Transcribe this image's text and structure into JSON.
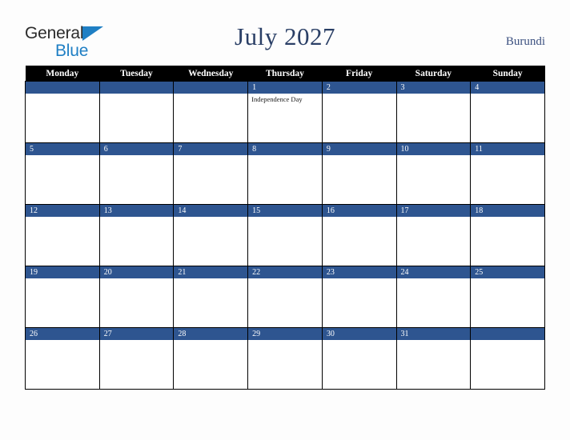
{
  "brand": {
    "name_part1": "General",
    "name_part2": "Blue",
    "triangle_color": "#1f7fc4",
    "text_color": "#2b2b2b"
  },
  "header": {
    "title": "July 2027",
    "country": "Burundi",
    "title_color": "#2a3f66"
  },
  "theme": {
    "day_bar_color": "#2e5590",
    "weekday_header_bg": "#000000",
    "weekday_header_text": "#ffffff",
    "grid_border": "#000000",
    "page_background": "#fdfdfd"
  },
  "calendar": {
    "month": "July",
    "year": "2027",
    "week_start": "Monday",
    "weekday_headers": [
      "Monday",
      "Tuesday",
      "Wednesday",
      "Thursday",
      "Friday",
      "Saturday",
      "Sunday"
    ],
    "weeks": [
      [
        {
          "date": "",
          "events": []
        },
        {
          "date": "",
          "events": []
        },
        {
          "date": "",
          "events": []
        },
        {
          "date": "1",
          "events": [
            "Independence Day"
          ]
        },
        {
          "date": "2",
          "events": []
        },
        {
          "date": "3",
          "events": []
        },
        {
          "date": "4",
          "events": []
        }
      ],
      [
        {
          "date": "5",
          "events": []
        },
        {
          "date": "6",
          "events": []
        },
        {
          "date": "7",
          "events": []
        },
        {
          "date": "8",
          "events": []
        },
        {
          "date": "9",
          "events": []
        },
        {
          "date": "10",
          "events": []
        },
        {
          "date": "11",
          "events": []
        }
      ],
      [
        {
          "date": "12",
          "events": []
        },
        {
          "date": "13",
          "events": []
        },
        {
          "date": "14",
          "events": []
        },
        {
          "date": "15",
          "events": []
        },
        {
          "date": "16",
          "events": []
        },
        {
          "date": "17",
          "events": []
        },
        {
          "date": "18",
          "events": []
        }
      ],
      [
        {
          "date": "19",
          "events": []
        },
        {
          "date": "20",
          "events": []
        },
        {
          "date": "21",
          "events": []
        },
        {
          "date": "22",
          "events": []
        },
        {
          "date": "23",
          "events": []
        },
        {
          "date": "24",
          "events": []
        },
        {
          "date": "25",
          "events": []
        }
      ],
      [
        {
          "date": "26",
          "events": []
        },
        {
          "date": "27",
          "events": []
        },
        {
          "date": "28",
          "events": []
        },
        {
          "date": "29",
          "events": []
        },
        {
          "date": "30",
          "events": []
        },
        {
          "date": "31",
          "events": []
        },
        {
          "date": "",
          "events": []
        }
      ]
    ]
  }
}
